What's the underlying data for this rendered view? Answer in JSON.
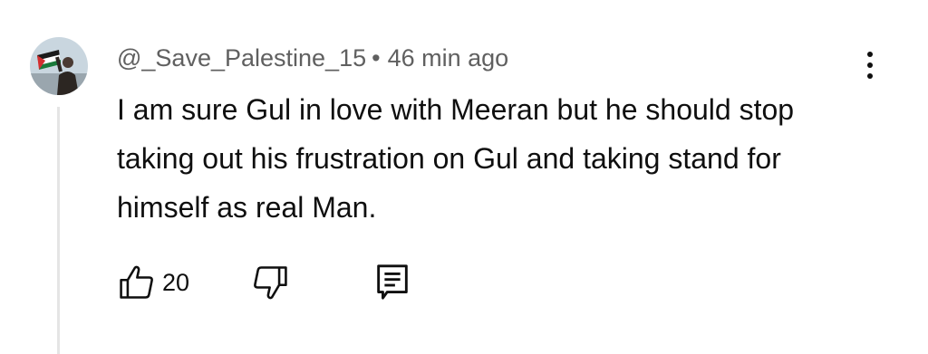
{
  "comment": {
    "author": "@_Save_Palestine_15",
    "separator": "•",
    "time_ago": "46 min ago",
    "text": "I am sure Gul in love with Meeran but he should stop taking out his frustration on Gul and taking stand for himself as real Man.",
    "like_count": "20"
  },
  "icons": {
    "like": "thumbs-up-icon",
    "dislike": "thumbs-down-icon",
    "reply": "reply-comment-icon",
    "menu": "more-vertical-icon"
  },
  "colors": {
    "text_primary": "#0f0f0f",
    "text_secondary": "#606060",
    "thread_line": "#e5e5e5",
    "flag_green": "#1a7a3a",
    "flag_red": "#d32f2f"
  }
}
